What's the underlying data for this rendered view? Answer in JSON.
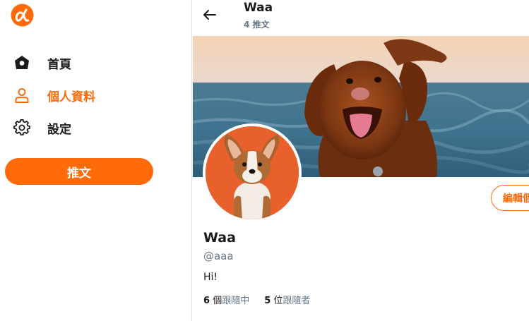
{
  "sidebar": {
    "logo_icon": "alpha-logo-icon",
    "items": [
      {
        "label": "首頁",
        "icon": "home-icon",
        "active": false
      },
      {
        "label": "個人資料",
        "icon": "user-icon",
        "active": true
      },
      {
        "label": "設定",
        "icon": "gear-icon",
        "active": false
      }
    ],
    "tweet_button": "推文"
  },
  "header": {
    "back_icon": "back-arrow-icon",
    "name": "Waa",
    "tweet_count": "4 推文"
  },
  "profile": {
    "name": "Waa",
    "handle": "@aaa",
    "bio": "Hi!",
    "edit_button": "編輯個人資料",
    "following": {
      "count": "6",
      "unit": "個",
      "label": "跟隨中"
    },
    "followers": {
      "count": "5",
      "unit": "位",
      "label": "跟隨者"
    }
  },
  "colors": {
    "accent": "#ff6b0b",
    "secondary_text": "#657786"
  }
}
